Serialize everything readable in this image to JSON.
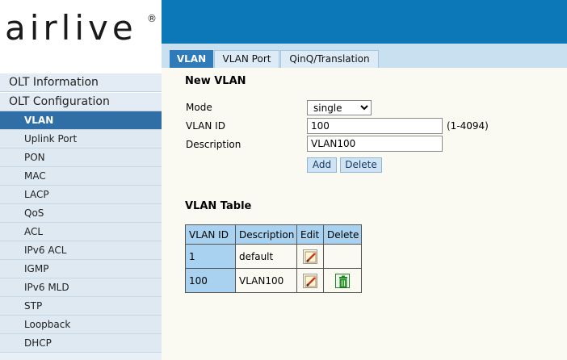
{
  "brand": {
    "logo_text": "airlive",
    "registered": "®"
  },
  "sidebar": {
    "groups": [
      "OLT Information",
      "OLT Configuration"
    ],
    "items": [
      "VLAN",
      "Uplink Port",
      "PON",
      "MAC",
      "LACP",
      "QoS",
      "ACL",
      "IPv6 ACL",
      "IGMP",
      "IPv6 MLD",
      "STP",
      "Loopback",
      "DHCP"
    ],
    "active_item": "VLAN"
  },
  "tabs": [
    {
      "label": "VLAN",
      "active": true
    },
    {
      "label": "VLAN Port",
      "active": false
    },
    {
      "label": "QinQ/Translation",
      "active": false
    }
  ],
  "new_vlan": {
    "title": "New VLAN",
    "mode_label": "Mode",
    "mode_value": "single",
    "vlan_id_label": "VLAN ID",
    "vlan_id_value": "100",
    "vlan_id_hint": "(1-4094)",
    "description_label": "Description",
    "description_value": "VLAN100",
    "add_label": "Add",
    "delete_label": "Delete"
  },
  "vlan_table": {
    "title": "VLAN Table",
    "headers": [
      "VLAN ID",
      "Description",
      "Edit",
      "Delete"
    ],
    "rows": [
      {
        "vlan_id": "1",
        "description": "default",
        "editable": true,
        "deletable": false
      },
      {
        "vlan_id": "100",
        "description": "VLAN100",
        "editable": true,
        "deletable": true
      }
    ]
  },
  "colors": {
    "banner": "#0c78b8",
    "active_tab": "#2f7ab8",
    "active_sidebar": "#2f6fa6",
    "table_header": "#a8d2ef"
  }
}
